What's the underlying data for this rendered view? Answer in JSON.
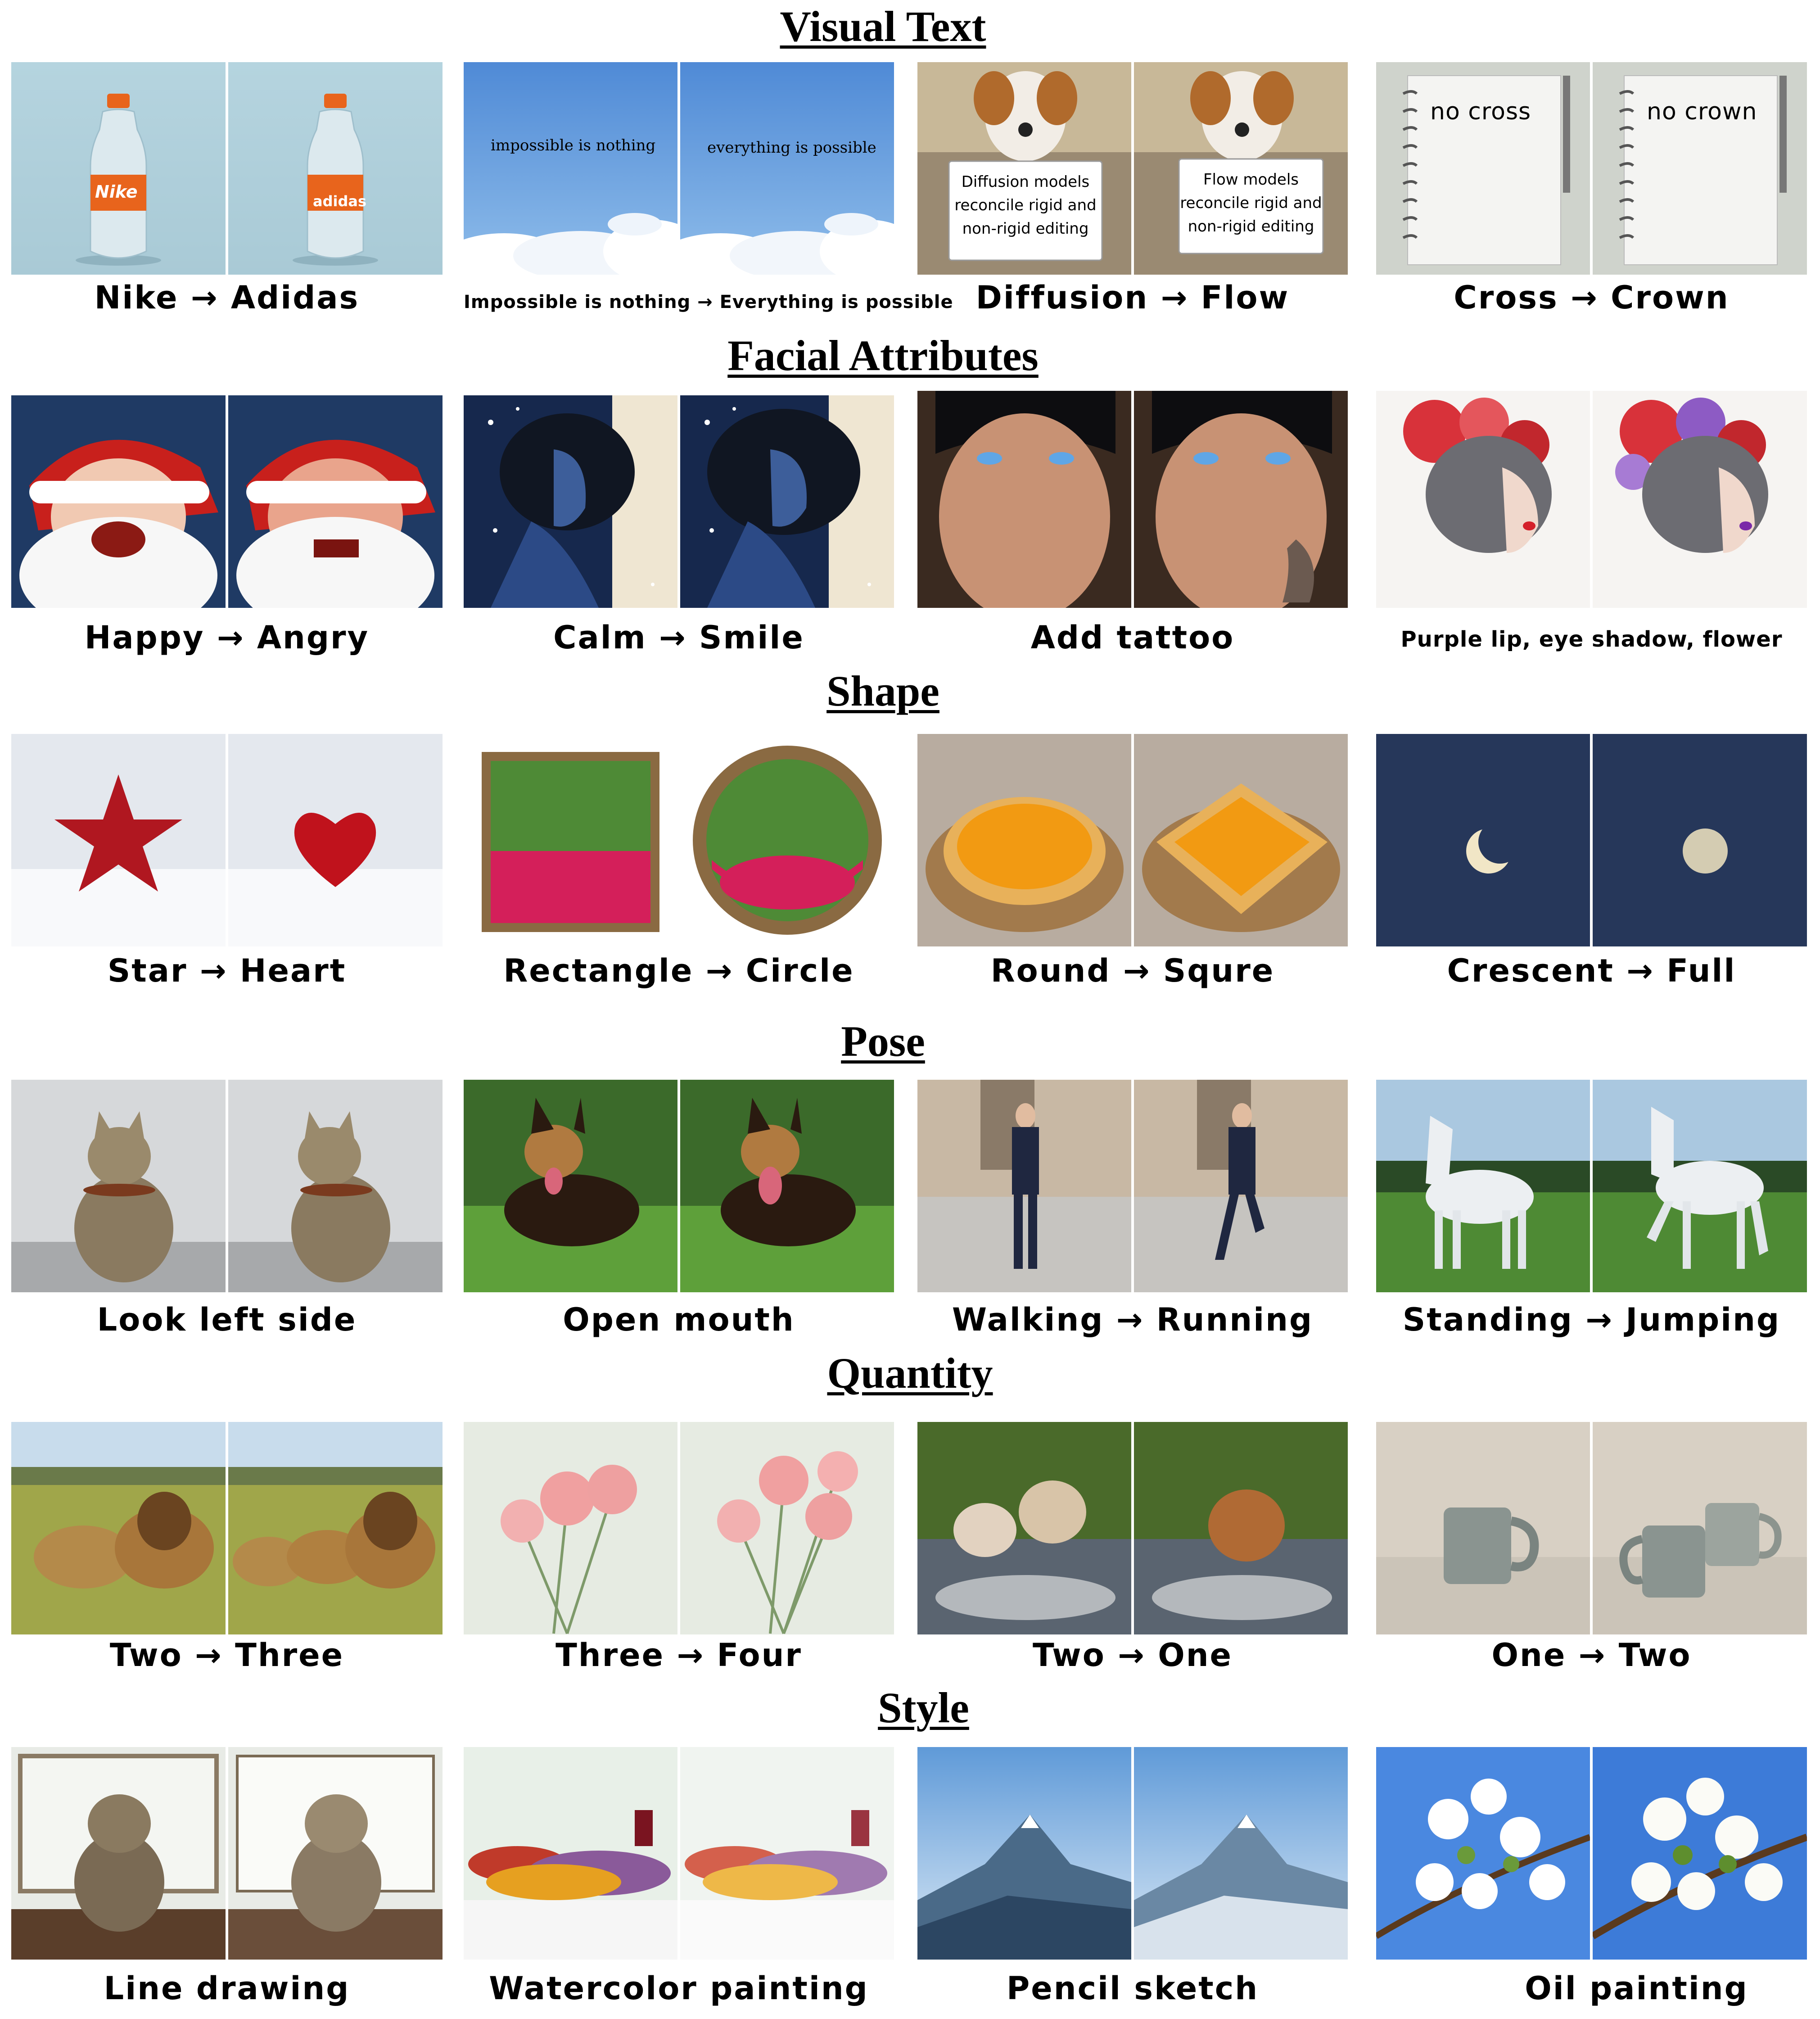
{
  "sections": [
    {
      "title": "Visual Text",
      "captions": [
        "Nike → Adidas",
        "Impossible is nothing → Everything is possible",
        "Diffusion → Flow",
        "Cross → Crown"
      ],
      "image_text": {
        "nike": "Nike",
        "adidas": "adidas",
        "impossible": "impossible is nothing",
        "everything": "everything  is possible",
        "sign_src": [
          "Diffusion models",
          "reconcile rigid and",
          "non-rigid editing"
        ],
        "sign_tgt": [
          "Flow models",
          "reconcile rigid and",
          "non-rigid editing"
        ],
        "note_src": "no cross",
        "note_tgt": "no crown"
      }
    },
    {
      "title": "Facial Attributes",
      "captions": [
        "Happy → Angry",
        "Calm → Smile",
        "Add tattoo",
        "Purple lip, eye shadow, flower"
      ]
    },
    {
      "title": "Shape",
      "captions": [
        "Star → Heart",
        "Rectangle → Circle",
        "Round → Squre",
        "Crescent → Full"
      ]
    },
    {
      "title": "Pose",
      "captions": [
        "Look left side",
        "Open mouth",
        "Walking → Running",
        "Standing → Jumping"
      ]
    },
    {
      "title": "Quantity",
      "captions": [
        "Two → Three",
        "Three → Four",
        "Two → One",
        "One → Two"
      ]
    },
    {
      "title": "Style",
      "captions": [
        "Line drawing",
        "Watercolor painting",
        "Pencil sketch",
        "Oil painting"
      ]
    }
  ],
  "colors": {
    "background": "#ffffff",
    "text": "#000000"
  }
}
